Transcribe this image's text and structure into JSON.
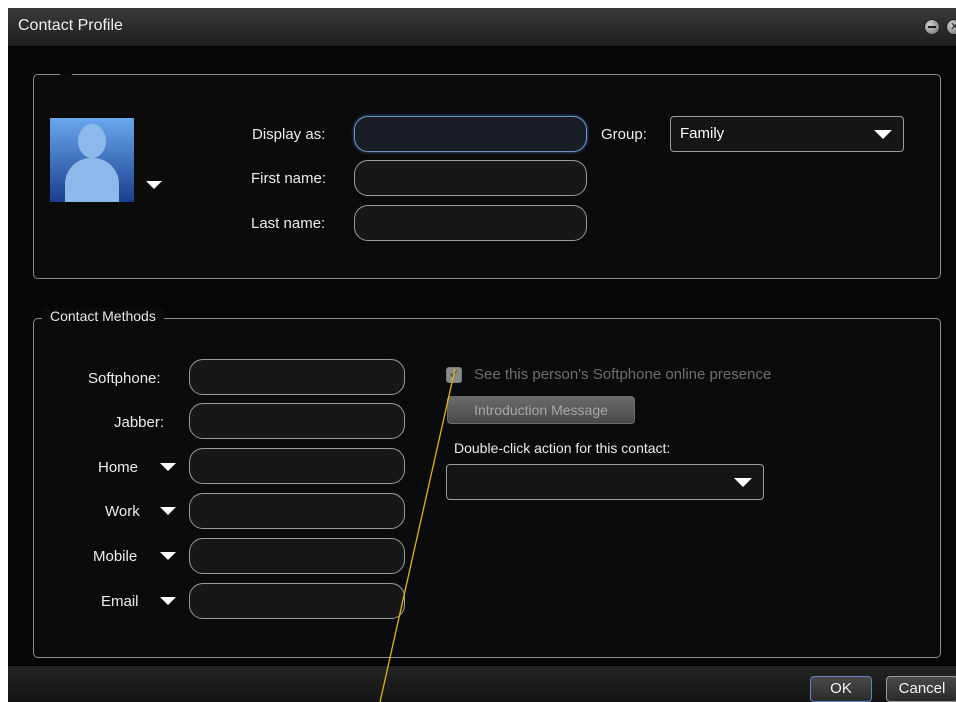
{
  "window": {
    "title": "Contact Profile"
  },
  "profile": {
    "display_as_label": "Display as:",
    "first_name_label": "First name:",
    "last_name_label": "Last name:",
    "group_label": "Group:",
    "group_value": "Family",
    "display_as_value": "",
    "first_name_value": "",
    "last_name_value": ""
  },
  "contact_methods": {
    "legend": "Contact Methods",
    "softphone_label": "Softphone:",
    "jabber_label": "Jabber:",
    "home_label": "Home",
    "work_label": "Work",
    "mobile_label": "Mobile",
    "email_label": "Email",
    "presence_checkbox_label": "See this person's Softphone online presence",
    "presence_checked": true,
    "presence_enabled": false,
    "intro_button_label": "Introduction Message",
    "double_click_label": "Double-click action for this contact:",
    "double_click_value": ""
  },
  "footer": {
    "ok_label": "OK",
    "cancel_label": "Cancel"
  },
  "colors": {
    "window_bg": "#0d0d0d",
    "focus_border": "#6f92c8",
    "annotation_line": "#e7b400"
  }
}
